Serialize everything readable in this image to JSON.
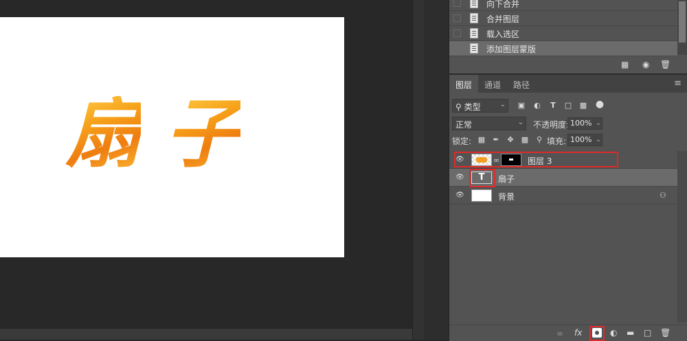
{
  "canvas": {
    "glyphs": [
      "扇",
      "子"
    ]
  },
  "history": {
    "items": [
      {
        "label": "向下合并",
        "selected": false
      },
      {
        "label": "合并图层",
        "selected": false
      },
      {
        "label": "载入选区",
        "selected": false
      },
      {
        "label": "添加图层蒙版",
        "selected": true
      }
    ],
    "footer_icons": [
      "new-snapshot-icon",
      "camera-icon",
      "trash-icon"
    ]
  },
  "layers_panel": {
    "tabs": [
      {
        "label": "图层",
        "active": true
      },
      {
        "label": "通道",
        "active": false
      },
      {
        "label": "路径",
        "active": false
      }
    ],
    "filter": {
      "label": "类型"
    },
    "filter_icons": [
      "pixel-filter-icon",
      "adjustment-filter-icon",
      "type-filter-icon",
      "shape-filter-icon",
      "smart-object-filter-icon",
      "filter-toggle-icon"
    ],
    "blend_mode": "正常",
    "opacity_label": "不透明度:",
    "opacity_value": "100%",
    "lock_label": "锁定:",
    "fill_label": "填充:",
    "fill_value": "100%",
    "layers": [
      {
        "name": "图层 3",
        "type": "pixel-with-mask",
        "visible": true,
        "selected": false,
        "highlighted": true
      },
      {
        "name": "扇子",
        "type": "text",
        "visible": true,
        "selected": true,
        "highlighted": false
      },
      {
        "name": "背景",
        "type": "background",
        "visible": true,
        "selected": false,
        "locked": true
      }
    ],
    "type_thumb_glyph": "T",
    "footer_icons": [
      "link-icon",
      "fx-icon",
      "add-mask-icon",
      "adjustment-icon",
      "folder-icon",
      "new-layer-icon",
      "trash-icon"
    ],
    "fx_label": "fx",
    "highlight_color": "#e02a2a"
  }
}
